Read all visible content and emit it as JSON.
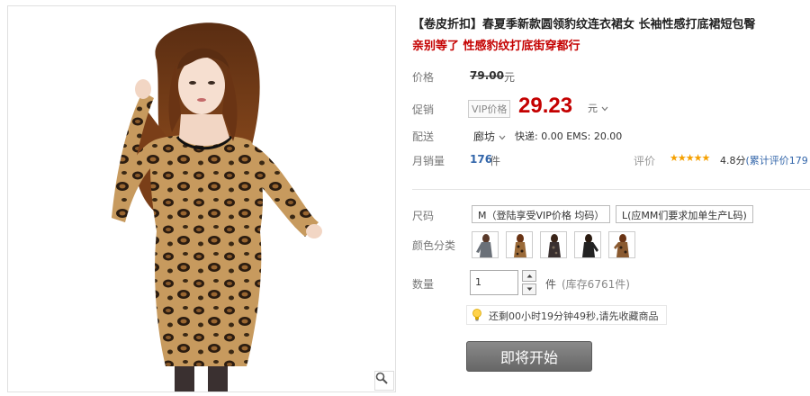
{
  "product": {
    "title": "【卷皮折扣】春夏季新款圆领豹纹连衣裙女 长袖性感打底裙短包臀",
    "subtitle": "亲别等了 性感豹纹打底街穿都行"
  },
  "price": {
    "label": "价格",
    "original": "79.00",
    "unit": "元"
  },
  "promo": {
    "label": "促销",
    "vip_tag": "VIP价格",
    "price": "29.23",
    "unit": "元"
  },
  "shipping": {
    "label": "配送",
    "location": "廊坊",
    "info": "快递: 0.00 EMS: 20.00"
  },
  "sales": {
    "label": "月销量",
    "count": "176",
    "unit": "件",
    "rating_label": "评价",
    "stars": "★★★★★",
    "rating": "4.8分",
    "review_count": "(累计评价179"
  },
  "size": {
    "label": "尺码",
    "options": [
      "M（登陆享受VIP价格 均码）",
      "L(应MM们要求加单生产L码)"
    ]
  },
  "color": {
    "label": "颜色分类"
  },
  "quantity": {
    "label": "数量",
    "value": "1",
    "unit": "件",
    "stock": "(库存6761件)"
  },
  "notice": {
    "text": "还剩00小时19分钟49秒,请先收藏商品"
  },
  "cta": {
    "label": "即将开始"
  },
  "icons": {
    "zoom": "magnifier-icon",
    "bulb": "lightbulb-icon",
    "dropdown": "chevron-down-icon"
  },
  "colors": {
    "promo_red": "#c40000",
    "link_blue": "#3366aa",
    "star_orange": "#f5a000",
    "cta_gray": "#777777"
  }
}
